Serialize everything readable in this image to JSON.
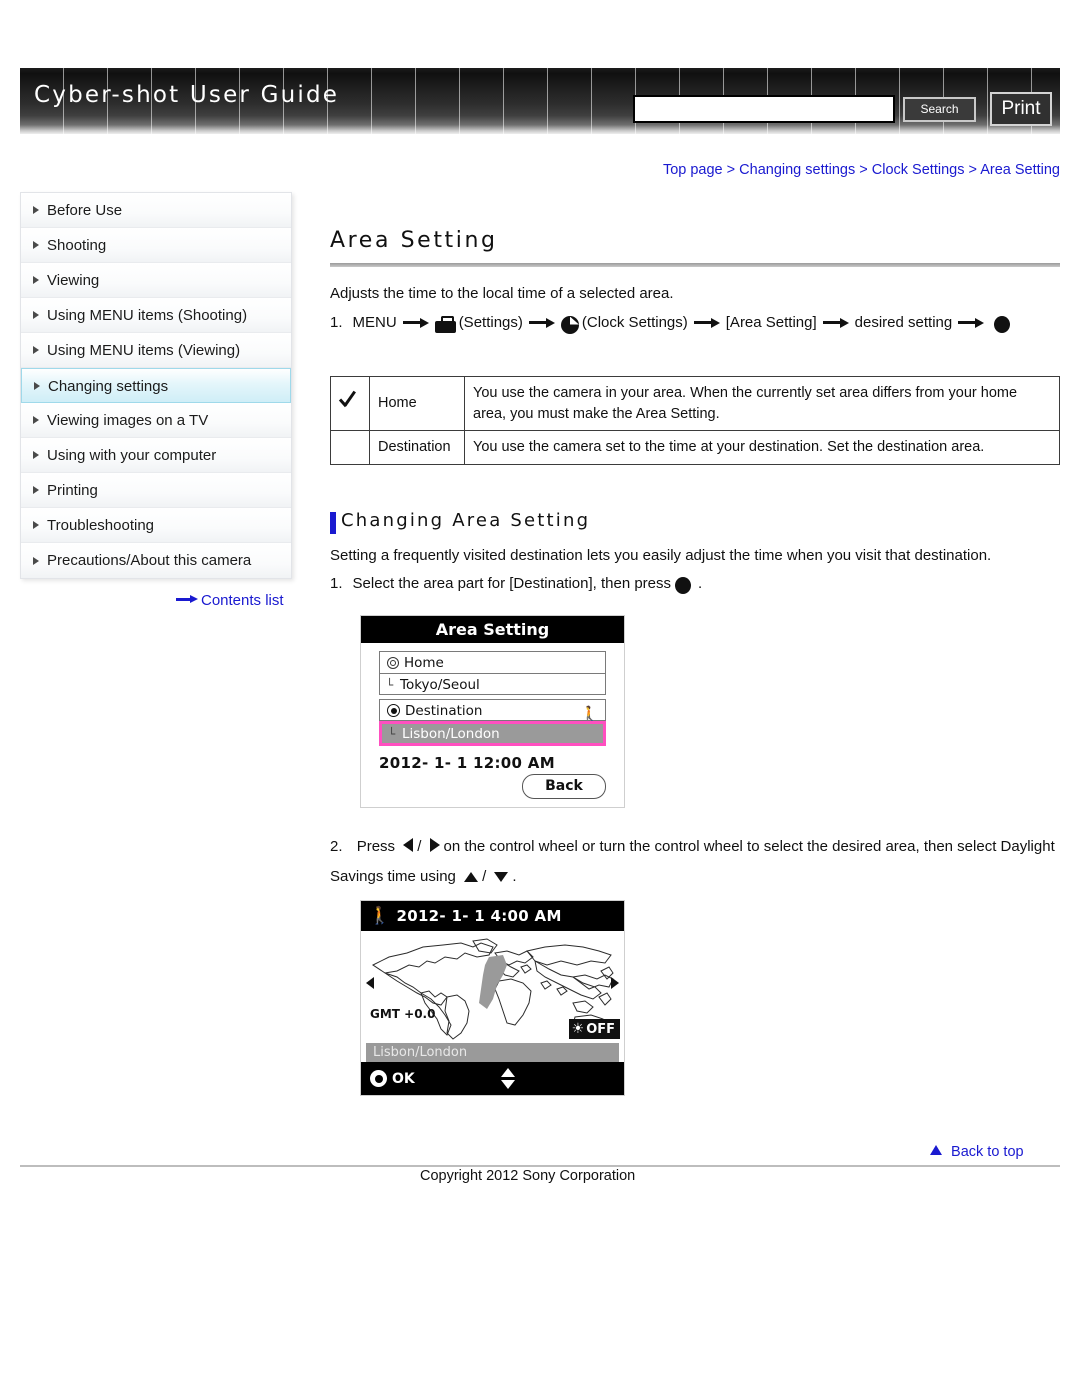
{
  "header": {
    "title": "Cyber-shot User Guide",
    "search_value": "",
    "search_placeholder": "",
    "search_button": "Search",
    "print_button": "Print"
  },
  "sidebar": {
    "items": [
      {
        "label": "Before Use",
        "active": false
      },
      {
        "label": "Shooting",
        "active": false
      },
      {
        "label": "Viewing",
        "active": false
      },
      {
        "label": "Using MENU items (Shooting)",
        "active": false
      },
      {
        "label": "Using MENU items (Viewing)",
        "active": false
      },
      {
        "label": "Changing settings",
        "active": true
      },
      {
        "label": "Viewing images on a TV",
        "active": false
      },
      {
        "label": "Using with your computer",
        "active": false
      },
      {
        "label": "Printing",
        "active": false
      },
      {
        "label": "Troubleshooting",
        "active": false
      },
      {
        "label": "Precautions/About this camera",
        "active": false
      }
    ],
    "contents_list": "Contents list"
  },
  "breadcrumb": {
    "items": [
      "Top page",
      "Changing settings",
      "Clock Settings",
      "Area Setting"
    ],
    "separator": ">"
  },
  "main": {
    "page_title": "Area Setting",
    "intro": "Adjusts the time to the local time of a selected area.",
    "menu_step": {
      "number": "1.",
      "menu_label": "MENU",
      "settings_label": "(Settings)",
      "clock_label": "(Clock Settings)",
      "area_label": "[Area Setting]",
      "desired_label": "desired setting"
    },
    "table": {
      "rows": [
        {
          "checked": true,
          "name": "Home",
          "desc": "You use the camera in your area. When the currently set area differs from your home area, you must make the Area Setting."
        },
        {
          "checked": false,
          "name": "Destination",
          "desc": "You use the camera set to the time at your destination. Set the destination area."
        }
      ]
    },
    "section": {
      "heading": "Changing Area Setting",
      "desc": "Setting a frequently visited destination lets you easily adjust the time when you visit that destination.",
      "step1": {
        "number": "1.",
        "text_before": "Select the area part for [Destination], then press",
        "text_after": "."
      },
      "step2": {
        "number": "2.",
        "part1": "Press",
        "part2": "/",
        "part3": "on the control wheel or turn the control wheel to select the desired area, then select Daylight Savings time using",
        "part4": "/",
        "part5": "."
      }
    },
    "camera_screen_1": {
      "title": "Area Setting",
      "rows": [
        {
          "icon": "home-ring-icon",
          "label": "Home",
          "selected": false
        },
        {
          "icon": "branch",
          "label": "Tokyo/Seoul",
          "selected": false
        },
        {
          "icon": "destination-radio-icon",
          "label": "Destination",
          "selected": false,
          "traveler": true
        },
        {
          "icon": "branch",
          "label": "Lisbon/London",
          "selected": true
        }
      ],
      "datetime": "2012- 1- 1 12:00 AM",
      "back_button": "Back"
    },
    "camera_screen_2": {
      "datetime": "2012-  1-  1   4:00 AM",
      "gmt": "GMT +0.0",
      "dst_label": "OFF",
      "city": "Lisbon/London",
      "ok_label": "OK"
    }
  },
  "footer": {
    "back_to_top": "Back to top",
    "copyright": "Copyright 2012 Sony Corporation"
  },
  "colors": {
    "link": "#1a1ad0",
    "accent_bar": "#1a1ad0",
    "selection_pink": "#ff4fc0",
    "sidebar_active": "#cfeef7"
  }
}
